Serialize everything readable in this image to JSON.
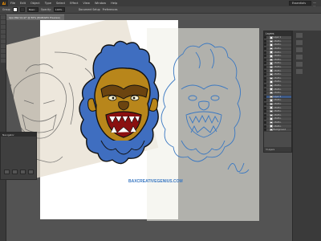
{
  "menubar": {
    "logo": "Ai",
    "items": [
      "File",
      "Edit",
      "Object",
      "Type",
      "Select",
      "Effect",
      "View",
      "Window",
      "Help"
    ],
    "workspace": "Essentials"
  },
  "controlbar": {
    "selection_label": "Group",
    "stroke_value": "Basic",
    "opacity_label": "Opacity:",
    "opacity_value": "100%",
    "style_label": "Document Setup",
    "prefs_label": "Preferences"
  },
  "document": {
    "tab_title": "Ape Warrior.ai* @ 50% (RGB/GPU Preview)"
  },
  "artwork": {
    "watermark": "BAXCREATIVEGENIUS.COM",
    "colors": {
      "fur": "#3f6ec0",
      "face": "#b8861b",
      "face_dark": "#6b4410",
      "line": "#111111",
      "sketch_line": "#3a78c2"
    }
  },
  "layers_panel": {
    "title": "Layers",
    "rows": [
      "Layer 1",
      "<Path>",
      "<Path>",
      "<Path>",
      "<Path>",
      "<Path>",
      "<Path>",
      "<Path>",
      "<Path>",
      "<Path>",
      "<Path>",
      "<Path>",
      "<Path>",
      "<Path>",
      "<Path>",
      "<Path>",
      "Layer 2",
      "<Path>",
      "<Path>",
      "<Path>",
      "<Path>",
      "<Path>",
      "<Path>",
      "<Path>",
      "<Path>",
      "Background"
    ],
    "selected_index": 16,
    "footer": "3 Layers"
  },
  "nav_panel": {
    "title": "Navigator"
  }
}
